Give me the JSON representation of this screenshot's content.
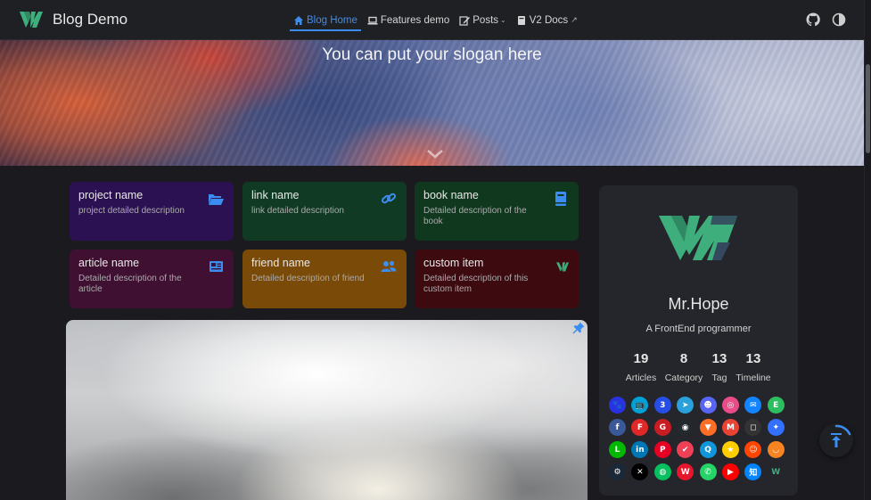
{
  "navbar": {
    "brand_title": "Blog Demo",
    "items": [
      {
        "label": "Blog Home",
        "icon": "home-icon",
        "active": true
      },
      {
        "label": "Features demo",
        "icon": "laptop-icon"
      },
      {
        "label": "Posts",
        "icon": "edit-icon",
        "dropdown": true
      },
      {
        "label": "V2 Docs",
        "icon": "book-icon",
        "external": true
      }
    ],
    "tools": [
      "github-icon",
      "theme-toggle-icon"
    ]
  },
  "hero": {
    "slogan": "You can put your slogan here"
  },
  "projects": [
    {
      "name": "project name",
      "desc": "project detailed description",
      "icon": "folder-open-icon",
      "color": "#2c1152",
      "icon_color": "#3c8df0"
    },
    {
      "name": "link name",
      "desc": "link detailed description",
      "icon": "link-icon",
      "color": "#103a23",
      "icon_color": "#3c8df0"
    },
    {
      "name": "book name",
      "desc": "Detailed description of the book",
      "icon": "book-icon",
      "color": "#10381f",
      "icon_color": "#3c8df0"
    },
    {
      "name": "article name",
      "desc": "Detailed description of the article",
      "icon": "newspaper-icon",
      "color": "#3f1032",
      "icon_color": "#3c8df0"
    },
    {
      "name": "friend name",
      "desc": "Detailed description of friend",
      "icon": "users-icon",
      "color": "#7a4a08",
      "icon_color": "#3c8df0"
    },
    {
      "name": "custom item",
      "desc": "Detailed description of this custom item",
      "icon": "vuepress-logo-icon",
      "color": "#3d0a10",
      "icon_color": "#3eaf7c"
    }
  ],
  "blogger": {
    "name": "Mr.Hope",
    "description": "A FrontEnd programmer",
    "stats": [
      {
        "num": "19",
        "label": "Articles"
      },
      {
        "num": "8",
        "label": "Category"
      },
      {
        "num": "13",
        "label": "Tag"
      },
      {
        "num": "13",
        "label": "Timeline"
      }
    ],
    "socials": [
      {
        "name": "baidu-icon",
        "color": "#2932e1",
        "glyph": "🐾"
      },
      {
        "name": "bilibili-icon",
        "color": "#00a1d6",
        "glyph": "📺"
      },
      {
        "name": "css3-icon",
        "color": "#264de4",
        "glyph": "3"
      },
      {
        "name": "telegram-icon",
        "color": "#2aa1da",
        "glyph": "➤"
      },
      {
        "name": "discord-icon",
        "color": "#5865f2",
        "glyph": "☻"
      },
      {
        "name": "dribbble-icon",
        "color": "#ea4c89",
        "glyph": "◎"
      },
      {
        "name": "email-icon",
        "color": "#1384ff",
        "glyph": "✉"
      },
      {
        "name": "evernote-icon",
        "color": "#2dbe60",
        "glyph": "E"
      },
      {
        "name": "facebook-icon",
        "color": "#3b5998",
        "glyph": "f"
      },
      {
        "name": "flipboard-icon",
        "color": "#e12828",
        "glyph": "F"
      },
      {
        "name": "gitee-icon",
        "color": "#c71d23",
        "glyph": "G"
      },
      {
        "name": "github-icon",
        "color": "#24292e",
        "glyph": "◉"
      },
      {
        "name": "gitlab-icon",
        "color": "#fc6d26",
        "glyph": "▼"
      },
      {
        "name": "gmail-icon",
        "color": "#ea4335",
        "glyph": "M"
      },
      {
        "name": "instagram-icon",
        "color": "#333333",
        "glyph": "◻"
      },
      {
        "name": "lark-icon",
        "color": "#3370ff",
        "glyph": "✦"
      },
      {
        "name": "line-icon",
        "color": "#00b900",
        "glyph": "L"
      },
      {
        "name": "linkedin-icon",
        "color": "#0077b5",
        "glyph": "in"
      },
      {
        "name": "pinterest-icon",
        "color": "#e60023",
        "glyph": "P"
      },
      {
        "name": "pocket-icon",
        "color": "#ef4056",
        "glyph": "✔"
      },
      {
        "name": "qq-icon",
        "color": "#1296db",
        "glyph": "Q"
      },
      {
        "name": "qzone-icon",
        "color": "#ffce00",
        "glyph": "★"
      },
      {
        "name": "reddit-icon",
        "color": "#ff4500",
        "glyph": "☺"
      },
      {
        "name": "rss-icon",
        "color": "#f78422",
        "glyph": "◡"
      },
      {
        "name": "steam-icon",
        "color": "#1b2838",
        "glyph": "⚙"
      },
      {
        "name": "x-twitter-icon",
        "color": "#000000",
        "glyph": "✕"
      },
      {
        "name": "wechat-icon",
        "color": "#07c160",
        "glyph": "◍"
      },
      {
        "name": "weibo-icon",
        "color": "#e6162d",
        "glyph": "W"
      },
      {
        "name": "whatsapp-icon",
        "color": "#25d366",
        "glyph": "✆"
      },
      {
        "name": "youtube-icon",
        "color": "#ff0000",
        "glyph": "▶"
      },
      {
        "name": "zhihu-icon",
        "color": "#0084ff",
        "glyph": "知"
      },
      {
        "name": "vuepress-hope-icon",
        "color": "#24262b",
        "glyph": "W"
      }
    ]
  },
  "colors": {
    "accent": "#3c8df0",
    "brand_green": "#3eaf7c",
    "brand_dark_green": "#35495e"
  }
}
